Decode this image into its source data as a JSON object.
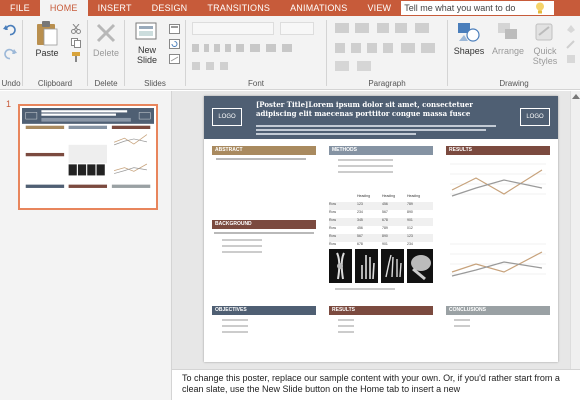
{
  "tabs": [
    "FILE",
    "HOME",
    "INSERT",
    "DESIGN",
    "TRANSITIONS",
    "ANIMATIONS",
    "VIEW"
  ],
  "tell_me": "Tell me what you want to do",
  "ribbon": {
    "undo_label": "Undo",
    "clipboard": {
      "label": "Clipboard",
      "paste": "Paste"
    },
    "delete": {
      "label": "Delete",
      "button": "Delete"
    },
    "slides": {
      "label": "Slides",
      "new_slide_line1": "New",
      "new_slide_line2": "Slide"
    },
    "font": {
      "label": "Font"
    },
    "paragraph": {
      "label": "Paragraph"
    },
    "drawing": {
      "label": "Drawing",
      "shapes": "Shapes",
      "arrange": "Arrange",
      "quick_line1": "Quick",
      "quick_line2": "Styles"
    }
  },
  "slide_number": "1",
  "poster": {
    "logo": "LOGO",
    "title": "[Poster Title]Lorem ipsum dolor sit amet, consectetuer adipiscing elit maecenas porttitor congue massa fusce",
    "sections": {
      "abstract": "ABSTRACT",
      "methods": "METHODS",
      "results": "RESULTS",
      "background": "BACKGROUND",
      "objectives": "OBJECTIVES",
      "results2": "RESULTS",
      "conclusions": "CONCLUSIONS"
    },
    "table_headers": [
      "Heading",
      "Heading",
      "Heading"
    ],
    "table_rows": [
      [
        "Row",
        "123",
        "456",
        "789"
      ],
      [
        "Row",
        "234",
        "567",
        "890"
      ],
      [
        "Row",
        "345",
        "678",
        "901"
      ],
      [
        "Row",
        "456",
        "789",
        "012"
      ],
      [
        "Row",
        "567",
        "890",
        "123"
      ],
      [
        "Row",
        "678",
        "901",
        "234"
      ]
    ]
  },
  "notes": "To change this poster, replace our sample content with your own. Or, if you'd rather start from a clean slate, use the New Slide button on the Home tab to insert a new",
  "colors": {
    "accent": "#c75b3a",
    "tan": "#a98a5f",
    "slate": "#8593a3",
    "brown": "#7b4a3f",
    "navy": "#4f5f73",
    "grey": "#9aa1a4"
  }
}
